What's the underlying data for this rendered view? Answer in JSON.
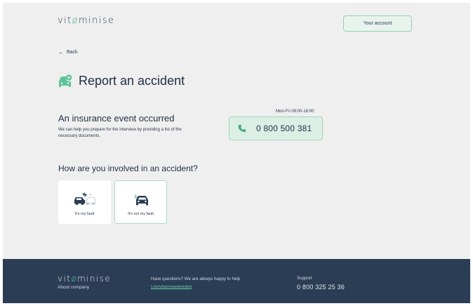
{
  "header": {
    "logo": {
      "prefix": "vit",
      "mark": "ø",
      "suffix": "minise"
    },
    "account_label": "Your account"
  },
  "nav": {
    "back_label": "Back",
    "back_icon": "arrow-left"
  },
  "page": {
    "title": "Report an accident",
    "title_icon": "car-plus-icon"
  },
  "event": {
    "title": "An insurance event occurred",
    "description": "We can help you prepare for the interview by providing a list of the necessary documents."
  },
  "contact": {
    "hours": "Mon-Fri 09:00-18:00",
    "phone": "0 800 500 381",
    "phone_icon": "phone-icon"
  },
  "involvement": {
    "question": "How are you involved in an accident?",
    "options": [
      {
        "label": "It's my fault",
        "icon": "car-collision-icon"
      },
      {
        "label": "It's not my fault",
        "icon": "car-hit-icon"
      }
    ]
  },
  "footer": {
    "logo": {
      "prefix": "vit",
      "mark": "ø",
      "suffix": "minise"
    },
    "about_label": "About company",
    "help_text": "Have questions? We are always happy to help",
    "telegram_link": "t.me/vitaminisedemobot",
    "support_label": "Support",
    "support_phone": "0 800 325 25 36"
  },
  "colors": {
    "background": "#efefef",
    "accent": "#4aa982",
    "accent_light": "#dcefe5",
    "text": "#1f2f45",
    "footer": "#2b3d55"
  }
}
